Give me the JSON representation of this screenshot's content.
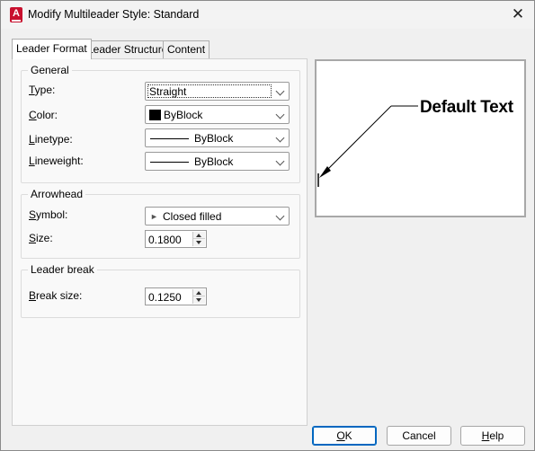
{
  "window": {
    "title": "Modify Multileader Style: Standard",
    "app_icon_letter": "A",
    "close_glyph": "✕"
  },
  "tabs": [
    {
      "label": "Leader Format",
      "active": true
    },
    {
      "label": "Leader Structure",
      "active": false
    },
    {
      "label": "Content",
      "active": false
    }
  ],
  "general": {
    "title": "General",
    "type_label": "Type:",
    "type_value": "Straight",
    "color_label": "Color:",
    "color_value": "ByBlock",
    "color_swatch": "#000000",
    "linetype_label": "Linetype:",
    "linetype_value": "ByBlock",
    "lineweight_label": "Lineweight:",
    "lineweight_value": "ByBlock"
  },
  "arrowhead": {
    "title": "Arrowhead",
    "symbol_label": "Symbol:",
    "symbol_value": "Closed filled",
    "size_label": "Size:",
    "size_value": "0.1800"
  },
  "leader_break": {
    "title": "Leader break",
    "break_size_label": "Break size:",
    "break_size_value": "0.1250"
  },
  "preview": {
    "text": "Default Text"
  },
  "buttons": {
    "ok": "OK",
    "cancel": "Cancel",
    "help": "Help"
  },
  "colors": {
    "app_icon": "#c8102e",
    "default_button_border": "#0067c0"
  }
}
